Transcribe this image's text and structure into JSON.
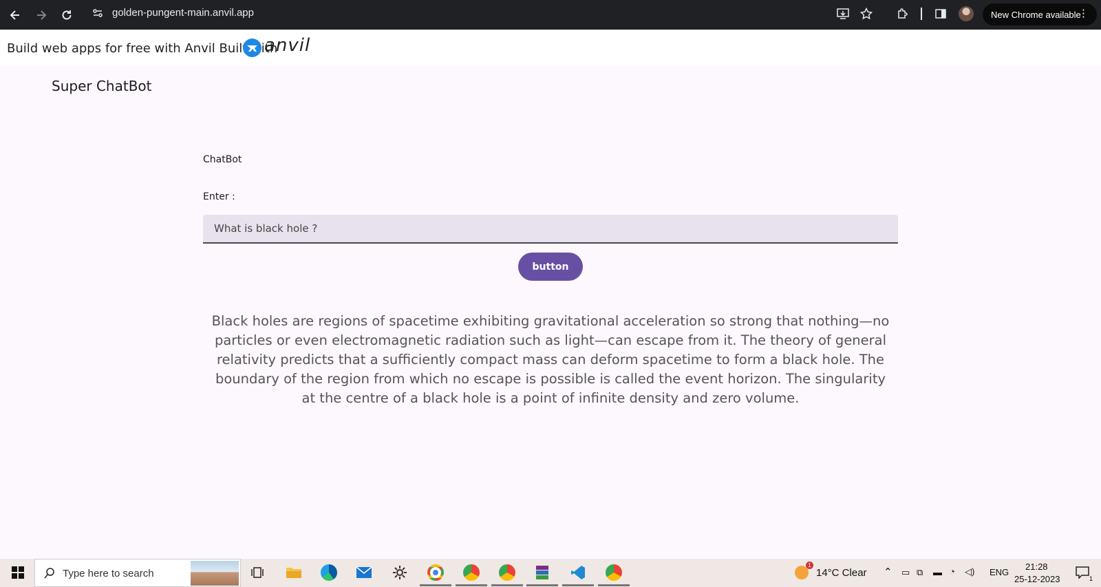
{
  "browser": {
    "url": "golden-pungent-main.anvil.app",
    "update_label": "New Chrome available"
  },
  "banner": {
    "text": "Build web apps for free with Anvil Built with",
    "logo_text": "anvil"
  },
  "app": {
    "title": "Super ChatBot",
    "section_label": "ChatBot",
    "enter_label": "Enter :",
    "input_value": "What is black hole ?",
    "button_label": "button",
    "answer": "Black holes are regions of spacetime exhibiting gravitational acceleration so strong that nothing—no particles or even electromagnetic radiation such as light—can escape from it. The theory of general relativity predicts that a sufficiently compact mass can deform spacetime to form a black hole. The boundary of the region from which no escape is possible is called the event horizon. The singularity at the centre of a black hole is a point of infinite density and zero volume."
  },
  "taskbar": {
    "search_placeholder": "Type here to search",
    "weather": "14°C  Clear",
    "weather_badge": "1",
    "language": "ENG",
    "time": "21:28",
    "date": "25-12-2023",
    "notification_count": "1"
  },
  "colors": {
    "accent": "#6750a4",
    "input_bg": "#e8e2ee",
    "page_bg": "#fdf8fd",
    "chrome_bar": "#202124"
  }
}
